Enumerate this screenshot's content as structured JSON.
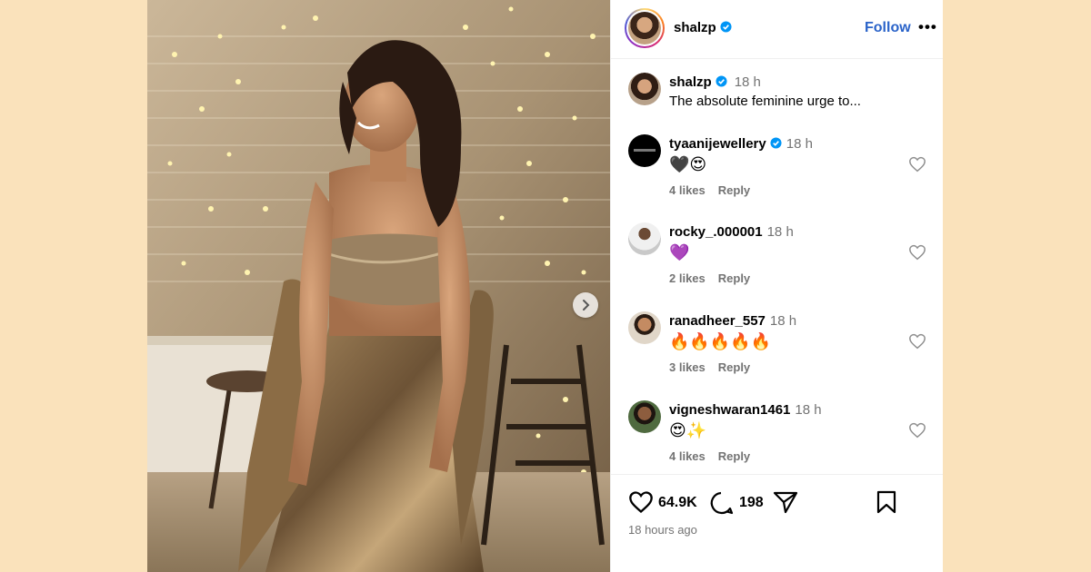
{
  "post": {
    "username": "shalzp",
    "follow_label": "Follow",
    "more_label": "•••",
    "caption": {
      "username": "shalzp",
      "time": "18 h",
      "text": "The absolute feminine urge to..."
    },
    "comments": [
      {
        "username": "tyaanijewellery",
        "verified": true,
        "time": "18 h",
        "text": "🖤😍",
        "likes": "4 likes",
        "reply": "Reply"
      },
      {
        "username": "rocky_.000001",
        "verified": false,
        "time": "18 h",
        "text": "💜",
        "likes": "2 likes",
        "reply": "Reply"
      },
      {
        "username": "ranadheer_557",
        "verified": false,
        "time": "18 h",
        "text": "🔥🔥🔥🔥🔥",
        "likes": "3 likes",
        "reply": "Reply"
      },
      {
        "username": "vigneshwaran1461",
        "verified": false,
        "time": "18 h",
        "text": "😍✨",
        "likes": "4 likes",
        "reply": "Reply"
      }
    ],
    "like_count": "64.9K",
    "comment_count": "198",
    "posted": "18 hours ago"
  },
  "icons": {
    "verified": "verified-badge-icon",
    "next": "chevron-right-icon",
    "like": "heart-icon",
    "comment": "comment-bubble-icon",
    "share": "paper-plane-icon",
    "save": "bookmark-icon"
  },
  "colors": {
    "page_background": "#fae2bb",
    "follow": "#2a63c9",
    "verified": "#0095f6",
    "muted": "#737373"
  }
}
